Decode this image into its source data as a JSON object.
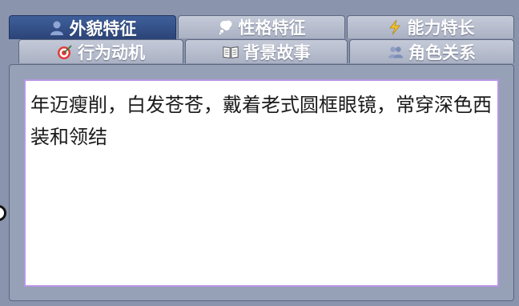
{
  "tabs_row1": [
    {
      "label": "外貌特征",
      "icon": "person-icon",
      "active": true
    },
    {
      "label": "性格特征",
      "icon": "thought-bubble-icon",
      "active": false
    },
    {
      "label": "能力特长",
      "icon": "lightning-icon",
      "active": false
    }
  ],
  "tabs_row2": [
    {
      "label": "行为动机",
      "icon": "target-icon"
    },
    {
      "label": "背景故事",
      "icon": "book-icon"
    },
    {
      "label": "角色关系",
      "icon": "people-icon"
    }
  ],
  "content": {
    "text": "年迈瘦削，白发苍苍，戴着老式圆框眼镜，常穿深色西装和领结"
  },
  "colors": {
    "background": "#8a94ad",
    "active_tab": "#2b4478",
    "inactive_tab": "#b8bfcf",
    "textarea_border": "#b996e6"
  }
}
